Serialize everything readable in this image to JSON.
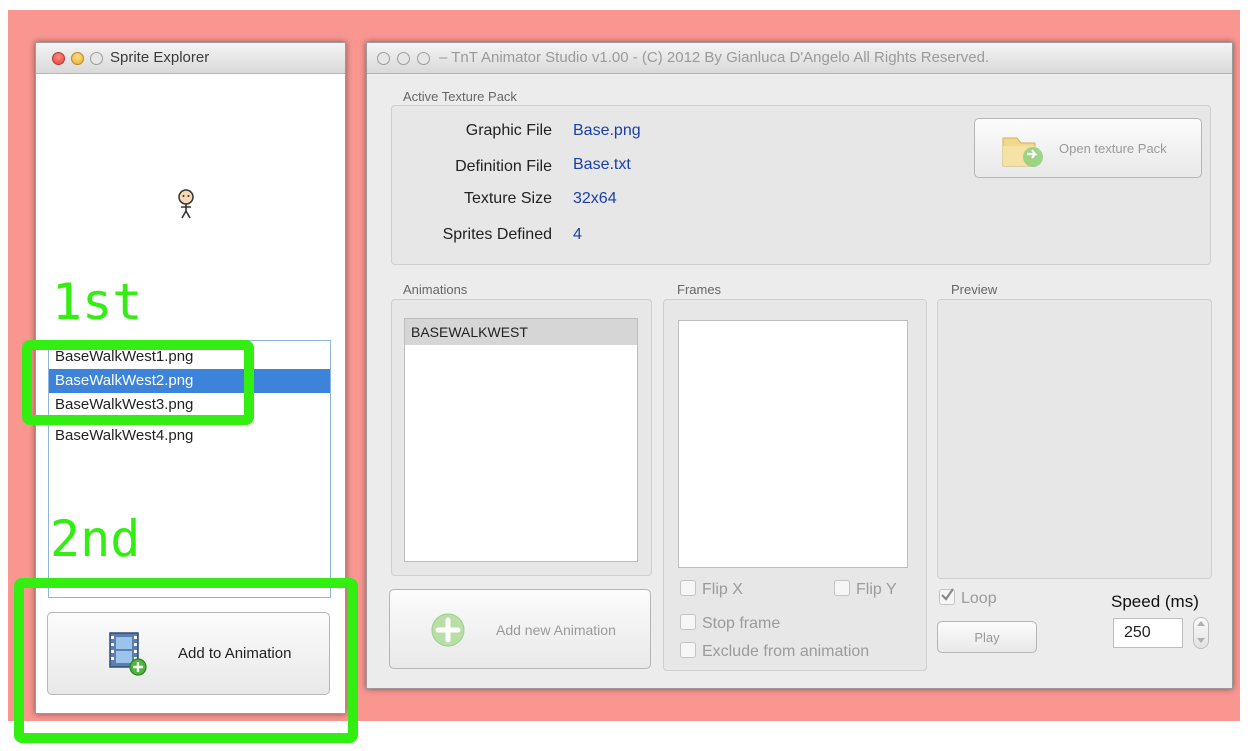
{
  "sprite_explorer": {
    "title": "Sprite Explorer",
    "files": [
      "BaseWalkWest1.png",
      "BaseWalkWest2.png",
      "BaseWalkWest3.png",
      "BaseWalkWest4.png"
    ],
    "selected_index": 1,
    "add_button_label": "Add to Animation",
    "add_button_icon": "film-add-icon"
  },
  "annotations": {
    "step1": "1st",
    "step2": "2nd",
    "color": "#33ee11"
  },
  "main": {
    "title": "TnT Animator Studio v1.00 - (C) 2012 By Gianluca D'Angelo All Rights Reserved.",
    "texture_group_label": "Active Texture Pack",
    "graphic_file_label": "Graphic File",
    "graphic_file_value": "Base.png",
    "definition_file_label": "Definition File",
    "definition_file_value": "Base.txt",
    "texture_size_label": "Texture Size",
    "texture_size_value": "32x64",
    "sprites_defined_label": "Sprites Defined",
    "sprites_defined_value": "4",
    "open_texture_label": "Open texture Pack",
    "animations_label": "Animations",
    "animations": [
      "BASEWALKWEST"
    ],
    "add_animation_label": "Add new Animation",
    "frames_label": "Frames",
    "flip_x": "Flip X",
    "flip_y": "Flip Y",
    "stop_frame": "Stop frame",
    "exclude": "Exclude from animation",
    "preview_label": "Preview",
    "loop_label": "Loop",
    "loop_checked": true,
    "speed_label": "Speed (ms)",
    "speed_value": "250",
    "play_label": "Play"
  }
}
